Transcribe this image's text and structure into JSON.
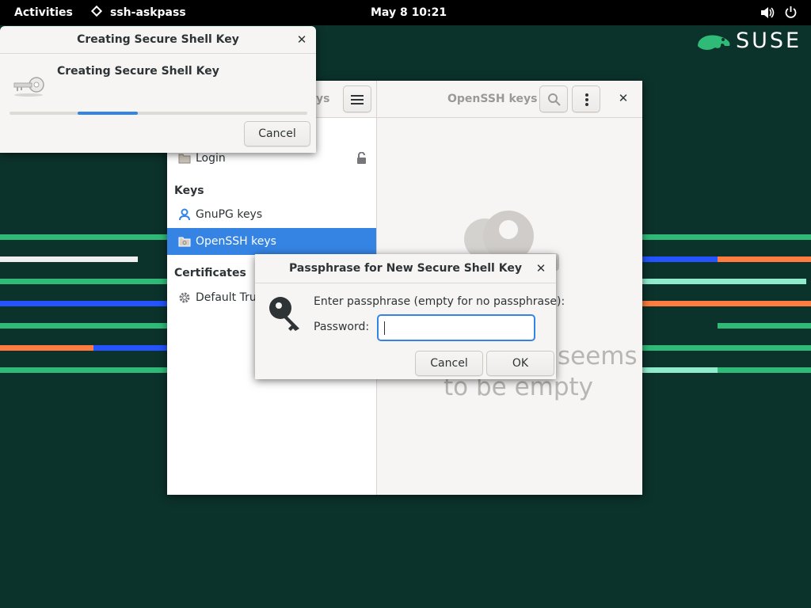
{
  "topbar": {
    "activities": "Activities",
    "app_name": "ssh-askpass",
    "clock": "May 8  10:21"
  },
  "desktop": {
    "brand": "SUSE"
  },
  "seahorse": {
    "header_left_partial": "ys",
    "header_title": "OpenSSH keys",
    "sidebar": {
      "login": "Login",
      "keys_heading": "Keys",
      "gnupg": "GnuPG keys",
      "openssh": "OpenSSH keys",
      "certificates_heading": "Certificates",
      "default_trust": "Default Trus"
    },
    "empty_line1": "seems",
    "empty_line2": "to be empty"
  },
  "progress_dialog": {
    "title": "Creating Secure Shell Key",
    "heading": "Creating Secure Shell Key",
    "cancel": "Cancel"
  },
  "passphrase_dialog": {
    "title": "Passphrase for New Secure Shell Key",
    "prompt": "Enter passphrase (empty for no passphrase):",
    "password_label": "Password:",
    "password_value": "",
    "cancel": "Cancel",
    "ok": "OK"
  },
  "colors": {
    "desktop_bg": "#0c322c",
    "suse_green": "#30ba78",
    "selection_blue": "#3584e4",
    "stripe_orange": "#fe7c3f",
    "stripe_blue": "#2453ff"
  }
}
